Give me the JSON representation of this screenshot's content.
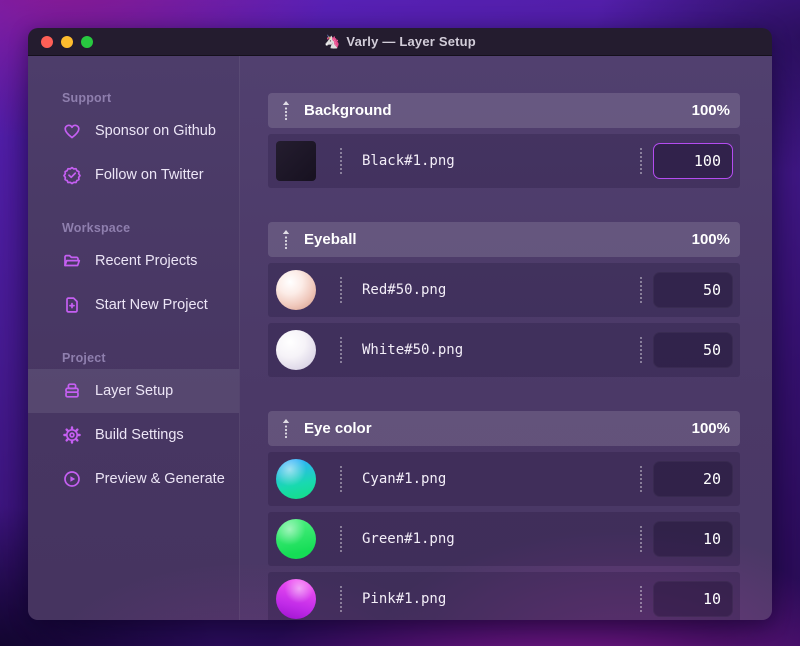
{
  "window": {
    "title": "Varly — Layer Setup",
    "app_icon": "🦄",
    "traffic_lights": [
      "close",
      "minimize",
      "zoom"
    ]
  },
  "sidebar": {
    "sections": [
      {
        "label": "Support",
        "items": [
          {
            "label": "Sponsor on Github",
            "icon": "heart-icon",
            "active": false
          },
          {
            "label": "Follow on Twitter",
            "icon": "verified-check-icon",
            "active": false
          }
        ]
      },
      {
        "label": "Workspace",
        "items": [
          {
            "label": "Recent Projects",
            "icon": "folder-open-icon",
            "active": false
          },
          {
            "label": "Start New Project",
            "icon": "file-plus-icon",
            "active": false
          }
        ]
      },
      {
        "label": "Project",
        "items": [
          {
            "label": "Layer Setup",
            "icon": "layers-icon",
            "active": true
          },
          {
            "label": "Build Settings",
            "icon": "gear-icon",
            "active": false
          },
          {
            "label": "Preview & Generate",
            "icon": "play-circle-icon",
            "active": false
          }
        ]
      }
    ]
  },
  "main": {
    "groups": [
      {
        "name": "Background",
        "percent": "100%",
        "layers": [
          {
            "file": "Black#1.png",
            "value": "100",
            "thumb": "black-square",
            "focused": true
          }
        ]
      },
      {
        "name": "Eyeball",
        "percent": "100%",
        "layers": [
          {
            "file": "Red#50.png",
            "value": "50",
            "thumb": "red-sphere",
            "focused": false
          },
          {
            "file": "White#50.png",
            "value": "50",
            "thumb": "white-sphere",
            "focused": false
          }
        ]
      },
      {
        "name": "Eye color",
        "percent": "100%",
        "layers": [
          {
            "file": "Cyan#1.png",
            "value": "20",
            "thumb": "cyan-sphere",
            "focused": false
          },
          {
            "file": "Green#1.png",
            "value": "10",
            "thumb": "green-sphere",
            "focused": false
          },
          {
            "file": "Pink#1.png",
            "value": "10",
            "thumb": "pink-sphere",
            "focused": false
          }
        ]
      }
    ]
  },
  "colors": {
    "accent_icon": "#c55ff2",
    "focus_border": "#b44cf0",
    "titlebar": "#241c2f",
    "traffic_red": "#ff5f57",
    "traffic_yellow": "#febc2e",
    "traffic_green": "#28c840"
  }
}
